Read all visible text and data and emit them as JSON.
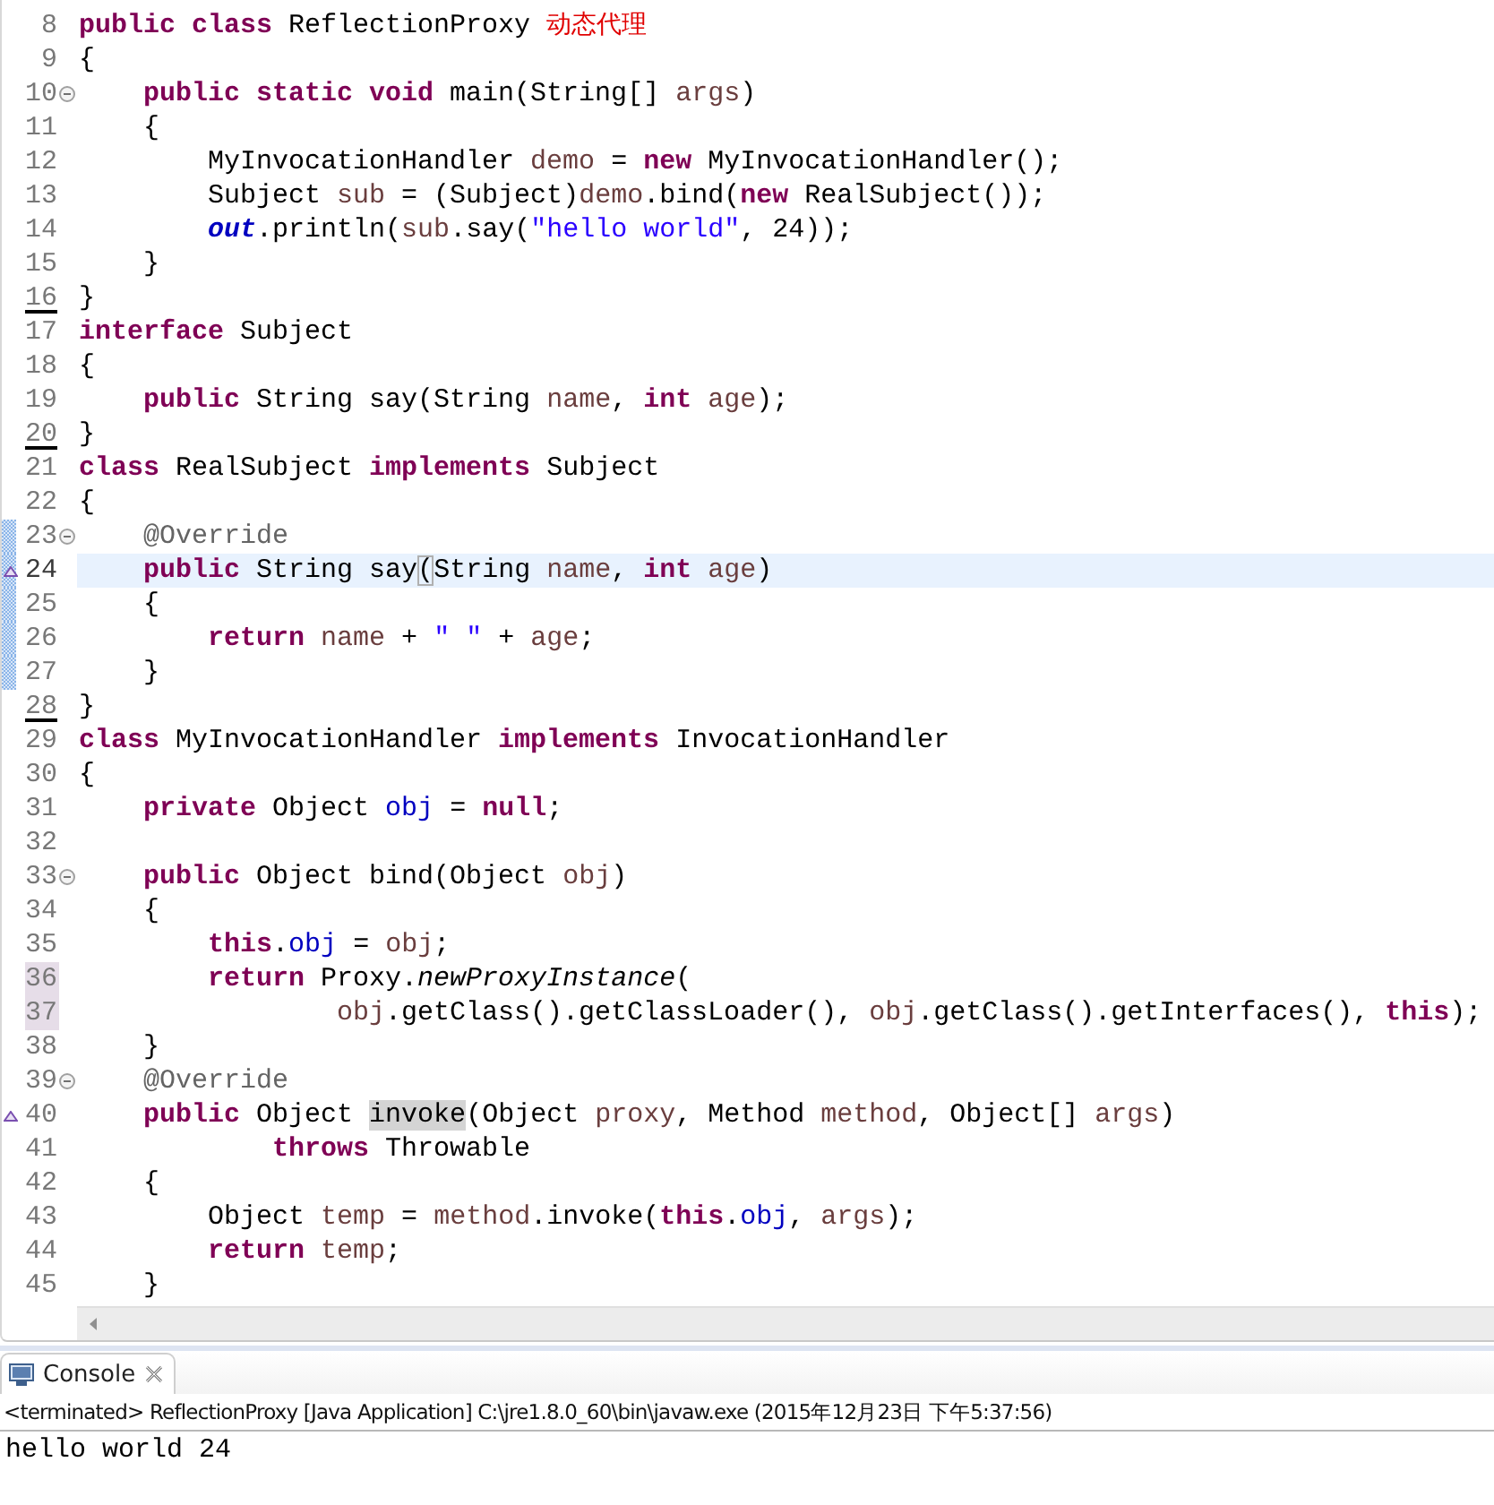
{
  "editor": {
    "lines": [
      {
        "number": "8",
        "fold": false,
        "override": false,
        "changed": false,
        "current": false,
        "underline": false,
        "range": false,
        "tokens": [
          {
            "kind": "kw",
            "text": "public class "
          },
          {
            "kind": "pl",
            "text": "ReflectionProxy "
          },
          {
            "kind": "note",
            "text": "动态代理"
          }
        ]
      },
      {
        "number": "9",
        "fold": false,
        "override": false,
        "changed": false,
        "current": false,
        "underline": false,
        "range": false,
        "tokens": [
          {
            "kind": "pl",
            "text": "{"
          }
        ]
      },
      {
        "number": "10",
        "fold": true,
        "override": false,
        "changed": false,
        "current": false,
        "underline": false,
        "range": false,
        "tokens": [
          {
            "kind": "kw",
            "text": "    public static void "
          },
          {
            "kind": "pl",
            "text": "main(String[] "
          },
          {
            "kind": "var",
            "text": "args"
          },
          {
            "kind": "pl",
            "text": ")"
          }
        ]
      },
      {
        "number": "11",
        "fold": false,
        "override": false,
        "changed": false,
        "current": false,
        "underline": false,
        "range": false,
        "tokens": [
          {
            "kind": "pl",
            "text": "    {"
          }
        ]
      },
      {
        "number": "12",
        "fold": false,
        "override": false,
        "changed": false,
        "current": false,
        "underline": false,
        "range": false,
        "tokens": [
          {
            "kind": "pl",
            "text": "        MyInvocationHandler "
          },
          {
            "kind": "var",
            "text": "demo"
          },
          {
            "kind": "pl",
            "text": " = "
          },
          {
            "kind": "kw",
            "text": "new "
          },
          {
            "kind": "pl",
            "text": "MyInvocationHandler();"
          }
        ]
      },
      {
        "number": "13",
        "fold": false,
        "override": false,
        "changed": false,
        "current": false,
        "underline": false,
        "range": false,
        "tokens": [
          {
            "kind": "pl",
            "text": "        Subject "
          },
          {
            "kind": "var",
            "text": "sub"
          },
          {
            "kind": "pl",
            "text": " = (Subject)"
          },
          {
            "kind": "var",
            "text": "demo"
          },
          {
            "kind": "pl",
            "text": ".bind("
          },
          {
            "kind": "kw",
            "text": "new "
          },
          {
            "kind": "pl",
            "text": "RealSubject());"
          }
        ]
      },
      {
        "number": "14",
        "fold": false,
        "override": false,
        "changed": false,
        "current": false,
        "underline": false,
        "range": false,
        "tokens": [
          {
            "kind": "sfd",
            "text": "        out"
          },
          {
            "kind": "pl",
            "text": ".println("
          },
          {
            "kind": "var",
            "text": "sub"
          },
          {
            "kind": "pl",
            "text": ".say("
          },
          {
            "kind": "str",
            "text": "\"hello world\""
          },
          {
            "kind": "pl",
            "text": ", 24));"
          }
        ]
      },
      {
        "number": "15",
        "fold": false,
        "override": false,
        "changed": false,
        "current": false,
        "underline": false,
        "range": false,
        "tokens": [
          {
            "kind": "pl",
            "text": "    }"
          }
        ]
      },
      {
        "number": "16",
        "fold": false,
        "override": false,
        "changed": false,
        "current": false,
        "underline": true,
        "range": false,
        "tokens": [
          {
            "kind": "pl",
            "text": "}"
          }
        ]
      },
      {
        "number": "17",
        "fold": false,
        "override": false,
        "changed": false,
        "current": false,
        "underline": false,
        "range": false,
        "tokens": [
          {
            "kind": "kw",
            "text": "interface "
          },
          {
            "kind": "pl",
            "text": "Subject"
          }
        ]
      },
      {
        "number": "18",
        "fold": false,
        "override": false,
        "changed": false,
        "current": false,
        "underline": false,
        "range": false,
        "tokens": [
          {
            "kind": "pl",
            "text": "{"
          }
        ]
      },
      {
        "number": "19",
        "fold": false,
        "override": false,
        "changed": false,
        "current": false,
        "underline": false,
        "range": false,
        "tokens": [
          {
            "kind": "kw",
            "text": "    public "
          },
          {
            "kind": "pl",
            "text": "String say(String "
          },
          {
            "kind": "var",
            "text": "name"
          },
          {
            "kind": "pl",
            "text": ", "
          },
          {
            "kind": "kw",
            "text": "int "
          },
          {
            "kind": "var",
            "text": "age"
          },
          {
            "kind": "pl",
            "text": ");"
          }
        ]
      },
      {
        "number": "20",
        "fold": false,
        "override": false,
        "changed": false,
        "current": false,
        "underline": true,
        "range": false,
        "tokens": [
          {
            "kind": "pl",
            "text": "}"
          }
        ]
      },
      {
        "number": "21",
        "fold": false,
        "override": false,
        "changed": false,
        "current": false,
        "underline": false,
        "range": false,
        "tokens": [
          {
            "kind": "kw",
            "text": "class "
          },
          {
            "kind": "pl",
            "text": "RealSubject "
          },
          {
            "kind": "kw",
            "text": "implements "
          },
          {
            "kind": "pl",
            "text": "Subject"
          }
        ]
      },
      {
        "number": "22",
        "fold": false,
        "override": false,
        "changed": false,
        "current": false,
        "underline": false,
        "range": false,
        "tokens": [
          {
            "kind": "pl",
            "text": "{"
          }
        ]
      },
      {
        "number": "23",
        "fold": true,
        "override": false,
        "changed": true,
        "current": false,
        "underline": false,
        "range": false,
        "tokens": [
          {
            "kind": "ann",
            "text": "    @Override"
          }
        ]
      },
      {
        "number": "24",
        "fold": false,
        "override": true,
        "changed": true,
        "current": true,
        "underline": false,
        "range": false,
        "tokens": [
          {
            "kind": "kw",
            "text": "    public "
          },
          {
            "kind": "pl",
            "text": "String say"
          },
          {
            "kind": "brk",
            "text": "("
          },
          {
            "kind": "pl",
            "text": "String "
          },
          {
            "kind": "var",
            "text": "name"
          },
          {
            "kind": "pl",
            "text": ", "
          },
          {
            "kind": "kw",
            "text": "int "
          },
          {
            "kind": "var",
            "text": "age"
          },
          {
            "kind": "pl",
            "text": ")"
          }
        ]
      },
      {
        "number": "25",
        "fold": false,
        "override": false,
        "changed": true,
        "current": false,
        "underline": false,
        "range": false,
        "tokens": [
          {
            "kind": "pl",
            "text": "    {"
          }
        ]
      },
      {
        "number": "26",
        "fold": false,
        "override": false,
        "changed": true,
        "current": false,
        "underline": false,
        "range": false,
        "tokens": [
          {
            "kind": "kw",
            "text": "        return "
          },
          {
            "kind": "var",
            "text": "name"
          },
          {
            "kind": "pl",
            "text": " + "
          },
          {
            "kind": "str",
            "text": "\" \""
          },
          {
            "kind": "pl",
            "text": " + "
          },
          {
            "kind": "var",
            "text": "age"
          },
          {
            "kind": "pl",
            "text": ";"
          }
        ]
      },
      {
        "number": "27",
        "fold": false,
        "override": false,
        "changed": true,
        "current": false,
        "underline": false,
        "range": false,
        "tokens": [
          {
            "kind": "pl",
            "text": "    }"
          }
        ]
      },
      {
        "number": "28",
        "fold": false,
        "override": false,
        "changed": false,
        "current": false,
        "underline": true,
        "range": false,
        "tokens": [
          {
            "kind": "pl",
            "text": "}"
          }
        ]
      },
      {
        "number": "29",
        "fold": false,
        "override": false,
        "changed": false,
        "current": false,
        "underline": false,
        "range": false,
        "tokens": [
          {
            "kind": "kw",
            "text": "class "
          },
          {
            "kind": "pl",
            "text": "MyInvocationHandler "
          },
          {
            "kind": "kw",
            "text": "implements "
          },
          {
            "kind": "pl",
            "text": "InvocationHandler"
          }
        ]
      },
      {
        "number": "30",
        "fold": false,
        "override": false,
        "changed": false,
        "current": false,
        "underline": false,
        "range": false,
        "tokens": [
          {
            "kind": "pl",
            "text": "{"
          }
        ]
      },
      {
        "number": "31",
        "fold": false,
        "override": false,
        "changed": false,
        "current": false,
        "underline": false,
        "range": false,
        "tokens": [
          {
            "kind": "kw",
            "text": "    private "
          },
          {
            "kind": "pl",
            "text": "Object "
          },
          {
            "kind": "fd",
            "text": "obj"
          },
          {
            "kind": "pl",
            "text": " = "
          },
          {
            "kind": "kw",
            "text": "null"
          },
          {
            "kind": "pl",
            "text": ";"
          }
        ]
      },
      {
        "number": "32",
        "fold": false,
        "override": false,
        "changed": false,
        "current": false,
        "underline": false,
        "range": false
      },
      {
        "number": "33",
        "fold": true,
        "override": false,
        "changed": false,
        "current": false,
        "underline": false,
        "range": false,
        "tokens": [
          {
            "kind": "kw",
            "text": "    public "
          },
          {
            "kind": "pl",
            "text": "Object bind(Object "
          },
          {
            "kind": "var",
            "text": "obj"
          },
          {
            "kind": "pl",
            "text": ")"
          }
        ]
      },
      {
        "number": "34",
        "fold": false,
        "override": false,
        "changed": false,
        "current": false,
        "underline": false,
        "range": false,
        "tokens": [
          {
            "kind": "pl",
            "text": "    {"
          }
        ]
      },
      {
        "number": "35",
        "fold": false,
        "override": false,
        "changed": false,
        "current": false,
        "underline": false,
        "range": false,
        "tokens": [
          {
            "kind": "kw",
            "text": "        this"
          },
          {
            "kind": "pl",
            "text": "."
          },
          {
            "kind": "fd",
            "text": "obj"
          },
          {
            "kind": "pl",
            "text": " = "
          },
          {
            "kind": "var",
            "text": "obj"
          },
          {
            "kind": "pl",
            "text": ";"
          }
        ]
      },
      {
        "number": "36",
        "fold": false,
        "override": false,
        "changed": false,
        "current": false,
        "underline": false,
        "range": true,
        "tokens": [
          {
            "kind": "kw",
            "text": "        return "
          },
          {
            "kind": "pl",
            "text": "Proxy."
          },
          {
            "kind": "smt",
            "text": "newProxyInstance"
          },
          {
            "kind": "pl",
            "text": "("
          }
        ]
      },
      {
        "number": "37",
        "fold": false,
        "override": false,
        "changed": false,
        "current": false,
        "underline": false,
        "range": true,
        "tokens": [
          {
            "kind": "var",
            "text": "                obj"
          },
          {
            "kind": "pl",
            "text": ".getClass().getClassLoader(), "
          },
          {
            "kind": "var",
            "text": "obj"
          },
          {
            "kind": "pl",
            "text": ".getClass().getInterfaces(), "
          },
          {
            "kind": "kw",
            "text": "this"
          },
          {
            "kind": "pl",
            "text": ");"
          }
        ]
      },
      {
        "number": "38",
        "fold": false,
        "override": false,
        "changed": false,
        "current": false,
        "underline": false,
        "range": false,
        "tokens": [
          {
            "kind": "pl",
            "text": "    }"
          }
        ]
      },
      {
        "number": "39",
        "fold": true,
        "override": false,
        "changed": false,
        "current": false,
        "underline": false,
        "range": false,
        "tokens": [
          {
            "kind": "ann",
            "text": "    @Override"
          }
        ]
      },
      {
        "number": "40",
        "fold": false,
        "override": true,
        "changed": false,
        "current": false,
        "underline": false,
        "range": false,
        "tokens": [
          {
            "kind": "kw",
            "text": "    public "
          },
          {
            "kind": "pl",
            "text": "Object "
          },
          {
            "kind": "occ",
            "text": "invoke"
          },
          {
            "kind": "pl",
            "text": "(Object "
          },
          {
            "kind": "var",
            "text": "proxy"
          },
          {
            "kind": "pl",
            "text": ", Method "
          },
          {
            "kind": "var",
            "text": "method"
          },
          {
            "kind": "pl",
            "text": ", Object[] "
          },
          {
            "kind": "var",
            "text": "args"
          },
          {
            "kind": "pl",
            "text": ")"
          }
        ]
      },
      {
        "number": "41",
        "fold": false,
        "override": false,
        "changed": false,
        "current": false,
        "underline": false,
        "range": false,
        "tokens": [
          {
            "kind": "kw",
            "text": "            throws "
          },
          {
            "kind": "pl",
            "text": "Throwable"
          }
        ]
      },
      {
        "number": "42",
        "fold": false,
        "override": false,
        "changed": false,
        "current": false,
        "underline": false,
        "range": false,
        "tokens": [
          {
            "kind": "pl",
            "text": "    {"
          }
        ]
      },
      {
        "number": "43",
        "fold": false,
        "override": false,
        "changed": false,
        "current": false,
        "underline": false,
        "range": false,
        "tokens": [
          {
            "kind": "pl",
            "text": "        Object "
          },
          {
            "kind": "var",
            "text": "temp"
          },
          {
            "kind": "pl",
            "text": " = "
          },
          {
            "kind": "var",
            "text": "method"
          },
          {
            "kind": "pl",
            "text": ".invoke("
          },
          {
            "kind": "kw",
            "text": "this"
          },
          {
            "kind": "pl",
            "text": "."
          },
          {
            "kind": "fd",
            "text": "obj"
          },
          {
            "kind": "pl",
            "text": ", "
          },
          {
            "kind": "var",
            "text": "args"
          },
          {
            "kind": "pl",
            "text": ");"
          }
        ]
      },
      {
        "number": "44",
        "fold": false,
        "override": false,
        "changed": false,
        "current": false,
        "underline": false,
        "range": false,
        "tokens": [
          {
            "kind": "kw",
            "text": "        return "
          },
          {
            "kind": "var",
            "text": "temp"
          },
          {
            "kind": "pl",
            "text": ";"
          }
        ]
      },
      {
        "number": "45",
        "fold": false,
        "override": false,
        "changed": false,
        "current": false,
        "underline": false,
        "range": false,
        "tokens": [
          {
            "kind": "pl",
            "text": "    }"
          }
        ]
      }
    ]
  },
  "console": {
    "tab": {
      "label": "Console",
      "selected": true
    },
    "status": "<terminated> ReflectionProxy [Java Application] C:\\jre1.8.0_60\\bin\\javaw.exe (2015年12月23日 下午5:37:56)",
    "output": [
      "hello world 24"
    ]
  }
}
